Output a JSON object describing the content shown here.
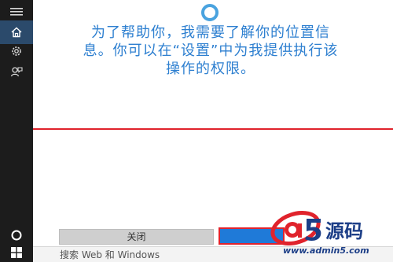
{
  "message": "为了帮助你，我需要了解你的位置信息。你可以在“设置”中为我提供执行该操作的权限。",
  "buttons": {
    "close_label": "关闭",
    "confirm_label": ""
  },
  "search": {
    "placeholder": "搜索 Web 和 Windows"
  },
  "sidebar": {
    "items": [
      {
        "icon": "menu-icon",
        "active": false
      },
      {
        "icon": "home-icon",
        "active": true
      },
      {
        "icon": "gear-icon",
        "active": false
      },
      {
        "icon": "feedback-icon",
        "active": false
      }
    ],
    "bottom_icons": [
      "cortana-circle-icon",
      "windows-start-icon"
    ]
  },
  "watermark": {
    "url": "www.admin5.com",
    "logo_text": "a5源码"
  },
  "colors": {
    "accent": "#2d7fd0",
    "sidebar_bg": "#1c1c1c",
    "divider": "#e0232c",
    "cortana_ring": "#4aa3df"
  }
}
